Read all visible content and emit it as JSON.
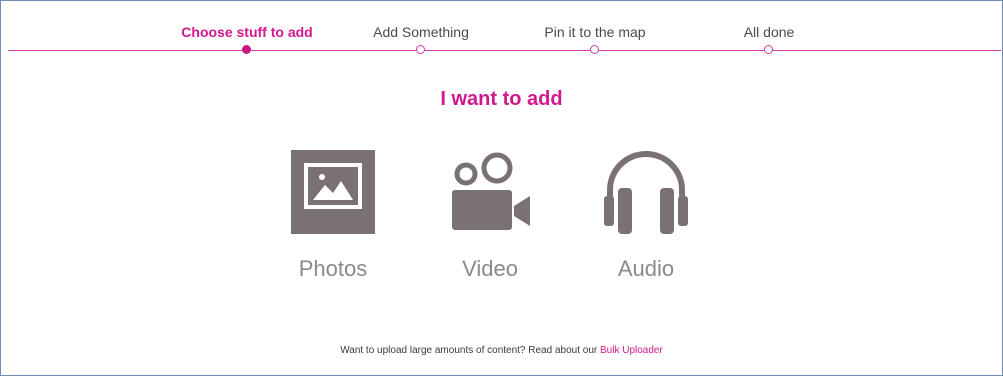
{
  "steps": [
    {
      "label": "Choose stuff to add",
      "active": true
    },
    {
      "label": "Add Something",
      "active": false
    },
    {
      "label": "Pin it to the map",
      "active": false
    },
    {
      "label": "All done",
      "active": false
    }
  ],
  "heading": "I want to add",
  "options": [
    {
      "label": "Photos",
      "icon": "photo-icon"
    },
    {
      "label": "Video",
      "icon": "video-camera-icon"
    },
    {
      "label": "Audio",
      "icon": "headphones-icon"
    }
  ],
  "footer": {
    "text": "Want to upload large amounts of content? Read about our",
    "link": "Bulk Uploader"
  },
  "colors": {
    "accent": "#d3188f",
    "icon": "#7a7272",
    "label": "#8a8a8a",
    "border": "#6d8fb8"
  }
}
